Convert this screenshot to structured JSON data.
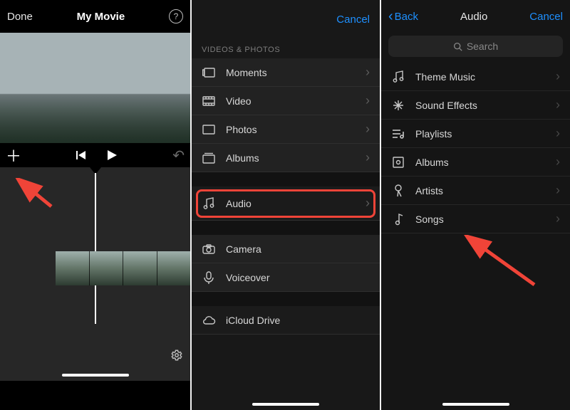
{
  "colors": {
    "accent": "#1e90ff",
    "highlight": "#f04438"
  },
  "panel1": {
    "done": "Done",
    "title": "My Movie",
    "help_tooltip": "?",
    "icons": {
      "add": "plus-icon",
      "previous": "prev-icon",
      "play": "play-icon",
      "undo": "undo-icon",
      "settings": "gear-icon"
    }
  },
  "panel2": {
    "cancel": "Cancel",
    "section_header": "VIDEOS & PHOTOS",
    "rows_top": [
      {
        "icon": "moments-icon",
        "label": "Moments"
      },
      {
        "icon": "video-icon",
        "label": "Video"
      },
      {
        "icon": "photos-icon",
        "label": "Photos"
      },
      {
        "icon": "albums-icon",
        "label": "Albums"
      }
    ],
    "audio_row": {
      "icon": "music-note-icon",
      "label": "Audio"
    },
    "rows_bottom": [
      {
        "icon": "camera-icon",
        "label": "Camera"
      },
      {
        "icon": "microphone-icon",
        "label": "Voiceover"
      }
    ],
    "icloud_row": {
      "icon": "cloud-icon",
      "label": "iCloud Drive"
    }
  },
  "panel3": {
    "back": "Back",
    "title": "Audio",
    "cancel": "Cancel",
    "search_placeholder": "Search",
    "rows": [
      {
        "icon": "music-note-icon",
        "label": "Theme Music"
      },
      {
        "icon": "sparkle-icon",
        "label": "Sound Effects"
      },
      {
        "icon": "playlist-icon",
        "label": "Playlists"
      },
      {
        "icon": "album-icon",
        "label": "Albums"
      },
      {
        "icon": "microphone-icon",
        "label": "Artists"
      },
      {
        "icon": "song-note-icon",
        "label": "Songs"
      }
    ]
  }
}
